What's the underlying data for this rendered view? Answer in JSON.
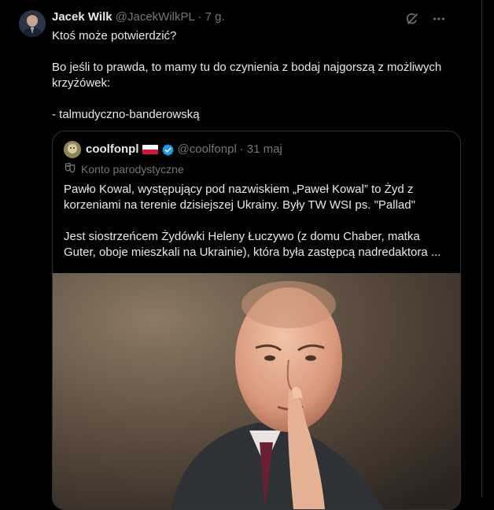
{
  "tweet": {
    "author_name": "Jacek Wilk",
    "author_handle": "@JacekWilkPL",
    "separator": "·",
    "time": "7 g.",
    "lines": [
      "Ktoś może potwierdzić?",
      "Bo jeśli to prawda, to mamy tu do czynienia z bodaj najgorszą z możliwych krzyżówek:",
      "- talmudyczno-banderowską"
    ]
  },
  "icons": {
    "grok": "grok-icon",
    "more": "more-icon"
  },
  "quoted": {
    "author_name": "coolfonpl",
    "author_handle": "@coolfonpl",
    "separator": "·",
    "time": "31 maj",
    "label": "Konto parodystyczne",
    "paragraphs": [
      "Pawło Kowal, występujący pod nazwiskiem „Paweł  Kowal” to Żyd z korzeniami na terenie dzisiejszej Ukrainy. Były TW WSI ps. \"Pallad\"",
      "Jest siostrzeńcem Żydówki Heleny Łuczywo (z domu Chaber, matka Guter, oboje mieszkali na Ukrainie), która była zastępcą nadredaktora ..."
    ]
  },
  "colors": {
    "background": "#000000",
    "text": "#e7e9ea",
    "secondary": "#71767b",
    "border": "#2f3336",
    "verified": "#1d9bf0"
  }
}
